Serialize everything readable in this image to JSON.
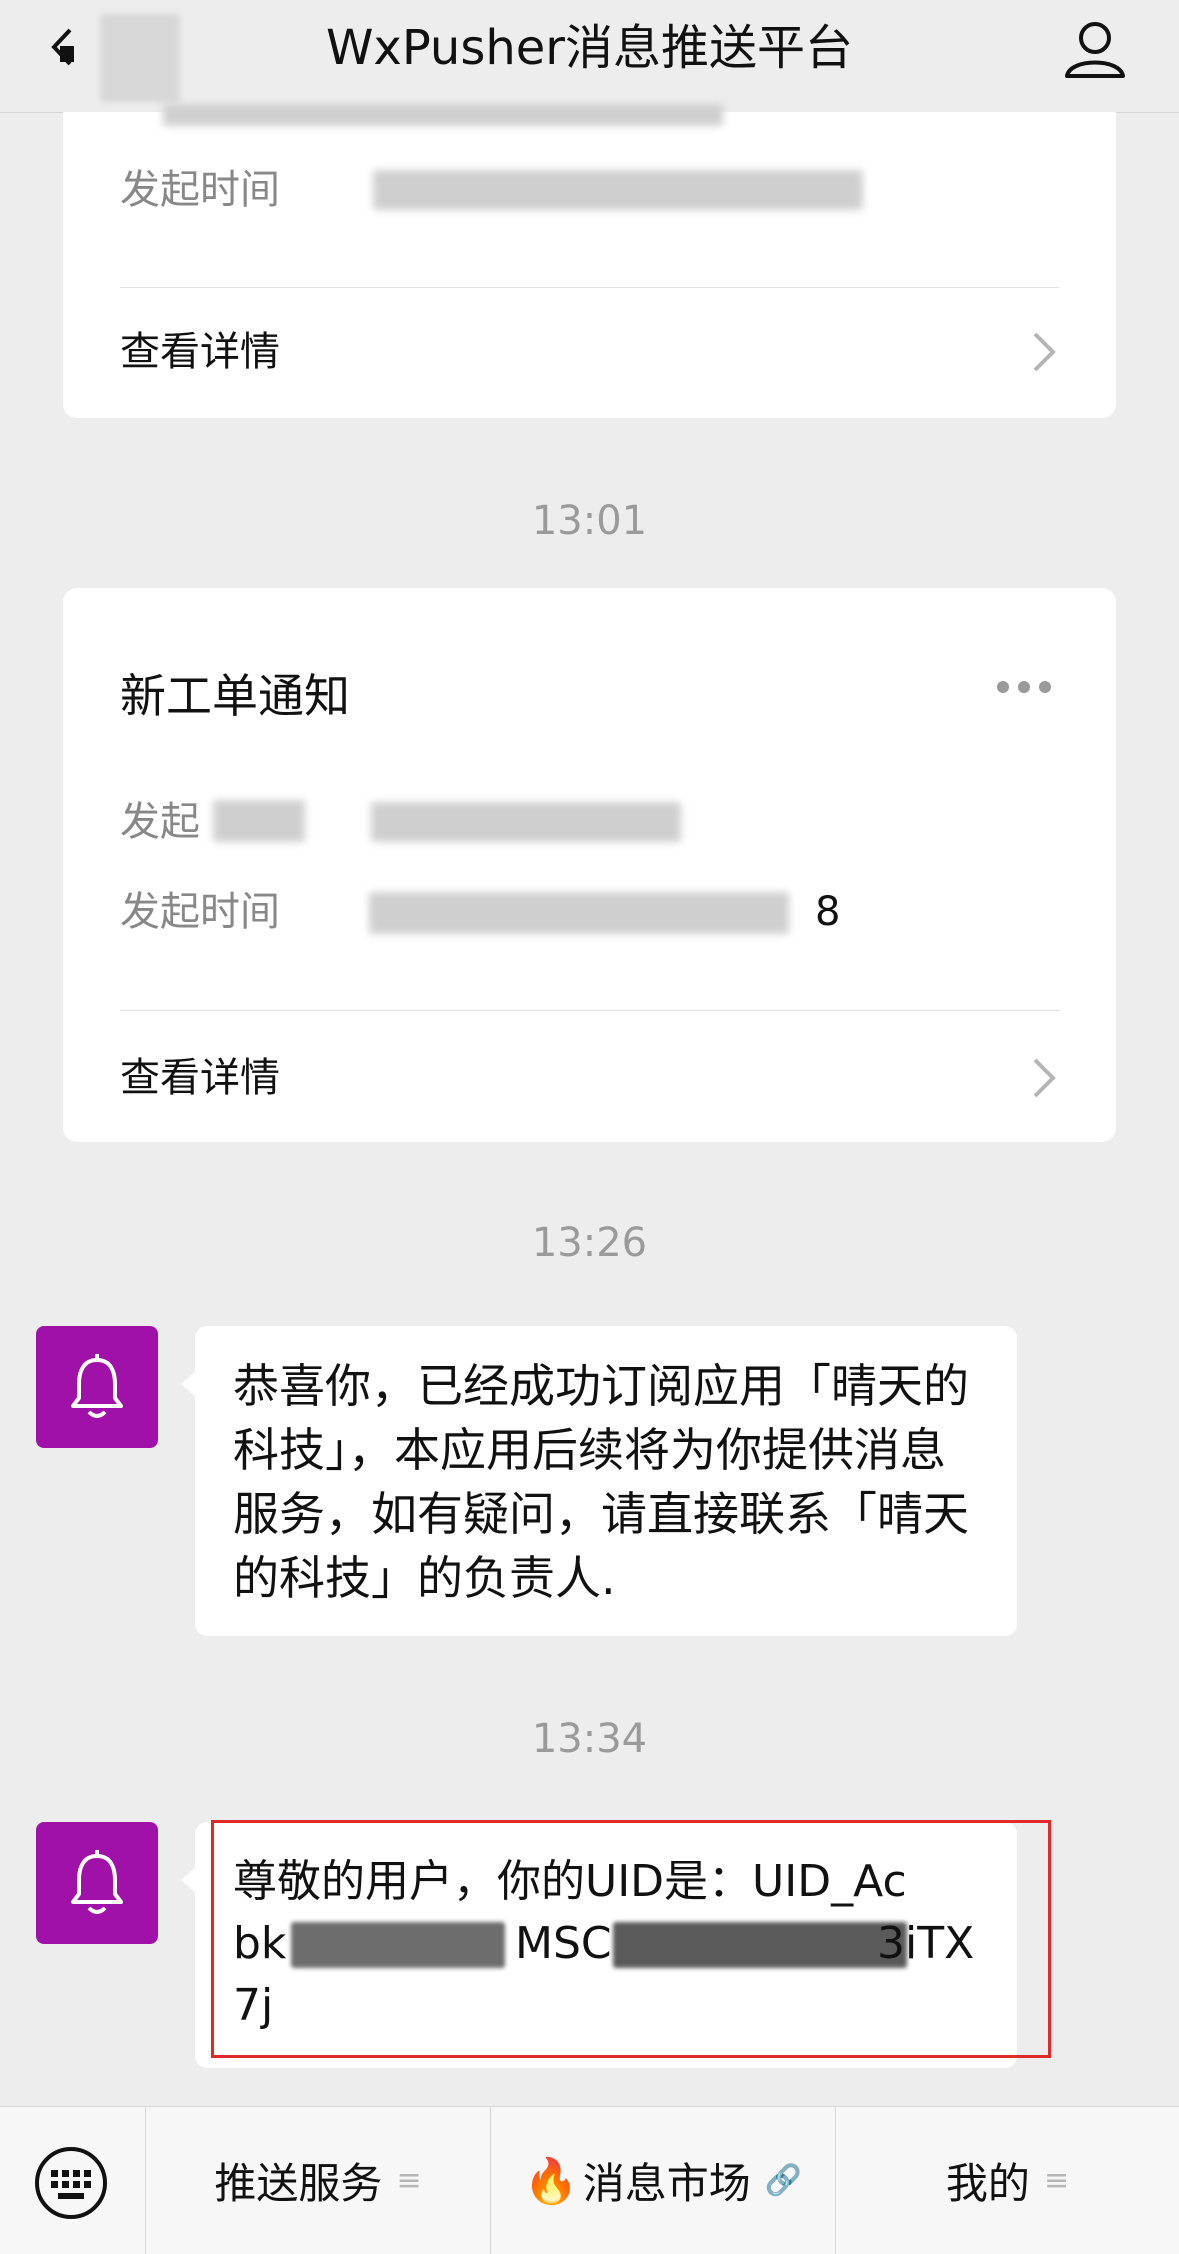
{
  "header": {
    "title": "WxPusher消息推送平台"
  },
  "card1": {
    "time_label": "发起时间",
    "detail_label": "查看详情"
  },
  "timestamps": [
    "13:01",
    "13:26",
    "13:34"
  ],
  "card2": {
    "title": "新工单通知",
    "reason_label": "发起",
    "time_label": "发起时间",
    "time_value_visible": "8",
    "detail_label": "查看详情"
  },
  "messages": [
    {
      "text": "恭喜你，已经成功订阅应用「晴天的科技」，本应用后续将为你提供消息服务，如有疑问，请直接联系「晴天的科技」的负责人."
    },
    {
      "text_line1": "尊敬的用户，你的UID是：UID_Ac",
      "text_line2_start": "bk",
      "text_line2_mid": "MSC",
      "text_line2_end": "3iTX",
      "text_line3": "7j"
    }
  ],
  "bottom_menu": [
    {
      "label": "推送服务",
      "suffix": "≡"
    },
    {
      "label": "消息市场",
      "suffix": "🔗"
    },
    {
      "label": "我的",
      "suffix": "≡"
    }
  ],
  "colors": {
    "background": "#ededed",
    "bot_avatar": "#a011a9",
    "highlight_border": "#e0292a"
  }
}
